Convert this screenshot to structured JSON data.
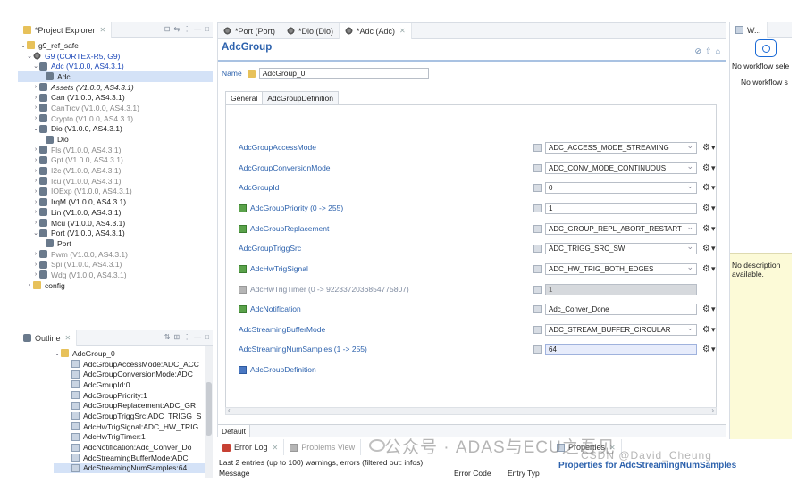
{
  "project_explorer": {
    "tab_label": "*Project Explorer",
    "tree": [
      {
        "label": "g9_ref_safe",
        "indent": 0,
        "twisty": "⌄",
        "icon": "folder",
        "style": ""
      },
      {
        "label": "G9 (CORTEX-R5, G9)",
        "indent": 1,
        "twisty": "⌄",
        "icon": "gear",
        "style": "blue"
      },
      {
        "label": "Adc (V1.0.0, AS4.3.1)",
        "indent": 2,
        "twisty": "⌄",
        "icon": "mod",
        "style": "blue"
      },
      {
        "label": "Adc",
        "indent": 3,
        "twisty": "",
        "icon": "mod",
        "style": "sel"
      },
      {
        "label": "Assets (V1.0.0, AS4.3.1)",
        "indent": 2,
        "twisty": "›",
        "icon": "mod",
        "style": "italic"
      },
      {
        "label": "Can (V1.0.0, AS4.3.1)",
        "indent": 2,
        "twisty": "›",
        "icon": "mod",
        "style": ""
      },
      {
        "label": "CanTrcv (V1.0.0, AS4.3.1)",
        "indent": 2,
        "twisty": "›",
        "icon": "mod",
        "style": "grey"
      },
      {
        "label": "Crypto (V1.0.0, AS4.3.1)",
        "indent": 2,
        "twisty": "›",
        "icon": "mod",
        "style": "grey"
      },
      {
        "label": "Dio (V1.0.0, AS4.3.1)",
        "indent": 2,
        "twisty": "⌄",
        "icon": "mod",
        "style": ""
      },
      {
        "label": "Dio",
        "indent": 3,
        "twisty": "",
        "icon": "mod",
        "style": ""
      },
      {
        "label": "Fls (V1.0.0, AS4.3.1)",
        "indent": 2,
        "twisty": "›",
        "icon": "mod",
        "style": "grey"
      },
      {
        "label": "Gpt (V1.0.0, AS4.3.1)",
        "indent": 2,
        "twisty": "›",
        "icon": "mod",
        "style": "grey"
      },
      {
        "label": "I2c (V1.0.0, AS4.3.1)",
        "indent": 2,
        "twisty": "›",
        "icon": "mod",
        "style": "grey"
      },
      {
        "label": "Icu (V1.0.0, AS4.3.1)",
        "indent": 2,
        "twisty": "›",
        "icon": "mod",
        "style": "grey"
      },
      {
        "label": "IOExp (V1.0.0, AS4.3.1)",
        "indent": 2,
        "twisty": "›",
        "icon": "mod",
        "style": "grey"
      },
      {
        "label": "IrqM (V1.0.0, AS4.3.1)",
        "indent": 2,
        "twisty": "›",
        "icon": "mod",
        "style": ""
      },
      {
        "label": "Lin (V1.0.0, AS4.3.1)",
        "indent": 2,
        "twisty": "›",
        "icon": "mod",
        "style": ""
      },
      {
        "label": "Mcu (V1.0.0, AS4.3.1)",
        "indent": 2,
        "twisty": "›",
        "icon": "mod",
        "style": ""
      },
      {
        "label": "Port (V1.0.0, AS4.3.1)",
        "indent": 2,
        "twisty": "⌄",
        "icon": "mod",
        "style": ""
      },
      {
        "label": "Port",
        "indent": 3,
        "twisty": "",
        "icon": "mod",
        "style": ""
      },
      {
        "label": "Pwm (V1.0.0, AS4.3.1)",
        "indent": 2,
        "twisty": "›",
        "icon": "mod",
        "style": "grey"
      },
      {
        "label": "Spi (V1.0.0, AS4.3.1)",
        "indent": 2,
        "twisty": "›",
        "icon": "mod",
        "style": "grey"
      },
      {
        "label": "Wdg (V1.0.0, AS4.3.1)",
        "indent": 2,
        "twisty": "›",
        "icon": "mod",
        "style": "grey"
      },
      {
        "label": "config",
        "indent": 1,
        "twisty": "›",
        "icon": "folder",
        "style": ""
      }
    ]
  },
  "outline": {
    "tab_label": "Outline",
    "items": [
      {
        "label": "AdcGroup_0",
        "indent": 0,
        "twisty": "⌄",
        "icon": "folder"
      },
      {
        "label": "AdcGroupAccessMode:ADC_ACC",
        "indent": 1,
        "twisty": "",
        "icon": "doc"
      },
      {
        "label": "AdcGroupConversionMode:ADC",
        "indent": 1,
        "twisty": "",
        "icon": "doc"
      },
      {
        "label": "AdcGroupId:0",
        "indent": 1,
        "twisty": "",
        "icon": "doc"
      },
      {
        "label": "AdcGroupPriority:1",
        "indent": 1,
        "twisty": "",
        "icon": "doc"
      },
      {
        "label": "AdcGroupReplacement:ADC_GR",
        "indent": 1,
        "twisty": "",
        "icon": "doc"
      },
      {
        "label": "AdcGroupTriggSrc:ADC_TRIGG_S",
        "indent": 1,
        "twisty": "",
        "icon": "doc"
      },
      {
        "label": "AdcHwTrigSignal:ADC_HW_TRIG",
        "indent": 1,
        "twisty": "",
        "icon": "doc"
      },
      {
        "label": "AdcHwTrigTimer:1",
        "indent": 1,
        "twisty": "",
        "icon": "doc"
      },
      {
        "label": "AdcNotification:Adc_Conver_Do",
        "indent": 1,
        "twisty": "",
        "icon": "doc"
      },
      {
        "label": "AdcStreamingBufferMode:ADC_",
        "indent": 1,
        "twisty": "",
        "icon": "doc"
      },
      {
        "label": "AdcStreamingNumSamples:64",
        "indent": 1,
        "twisty": "",
        "icon": "doc"
      }
    ]
  },
  "editor": {
    "tabs": [
      {
        "label": "*Port (Port)",
        "active": false
      },
      {
        "label": "*Dio (Dio)",
        "active": false
      },
      {
        "label": "*Adc (Adc)",
        "active": true
      }
    ],
    "title": "AdcGroup",
    "name_label": "Name",
    "name_value": "AdcGroup_0",
    "form_tabs": [
      "General",
      "AdcGroupDefinition"
    ],
    "params": [
      {
        "label": "AdcGroupAccessMode",
        "value": "ADC_ACCESS_MODE_STREAMING",
        "kind": "combo",
        "lead": "",
        "greyed": false
      },
      {
        "label": "AdcGroupConversionMode",
        "value": "ADC_CONV_MODE_CONTINUOUS",
        "kind": "combo",
        "lead": "",
        "greyed": false
      },
      {
        "label": "AdcGroupId",
        "value": "0",
        "kind": "combo",
        "lead": "",
        "greyed": false
      },
      {
        "label": "AdcGroupPriority (0 -> 255)",
        "value": "1",
        "kind": "text",
        "lead": "green",
        "greyed": false
      },
      {
        "label": "AdcGroupReplacement",
        "value": "ADC_GROUP_REPL_ABORT_RESTART",
        "kind": "combo",
        "lead": "green",
        "greyed": false
      },
      {
        "label": "AdcGroupTriggSrc",
        "value": "ADC_TRIGG_SRC_SW",
        "kind": "combo",
        "lead": "",
        "greyed": false
      },
      {
        "label": "AdcHwTrigSignal",
        "value": "ADC_HW_TRIG_BOTH_EDGES",
        "kind": "combo",
        "lead": "green",
        "greyed": false
      },
      {
        "label": "AdcHwTrigTimer (0 -> 9223372036854775807)",
        "value": "1",
        "kind": "disabled",
        "lead": "grey",
        "greyed": true
      },
      {
        "label": "AdcNotification",
        "value": "Adc_Conver_Done",
        "kind": "text",
        "lead": "green",
        "greyed": false
      },
      {
        "label": "AdcStreamingBufferMode",
        "value": "ADC_STREAM_BUFFER_CIRCULAR",
        "kind": "combo",
        "lead": "",
        "greyed": false
      },
      {
        "label": "AdcStreamingNumSamples (1 -> 255)",
        "value": "64",
        "kind": "hl",
        "lead": "",
        "greyed": false
      },
      {
        "label": "AdcGroupDefinition",
        "value": "",
        "kind": "link",
        "lead": "blue",
        "greyed": false
      }
    ],
    "bottom_tab": "Default"
  },
  "workflow": {
    "tab_label": "W...",
    "line1": "No workflow sele",
    "line2": "No workflow s",
    "description": "No description available."
  },
  "error_log": {
    "tabs": [
      "Error Log",
      "Problems View"
    ],
    "summary": "Last 2 entries (up to 100) warnings, errors (filtered out: infos)",
    "col_message": "Message",
    "col_error_code": "Error Code",
    "col_entry_type": "Entry Typ"
  },
  "properties": {
    "tab_label": "Properties",
    "title": "Properties for AdcStreamingNumSamples"
  },
  "watermark": "公众号 · ADAS与ECU之吾见",
  "watermark_sub": "CSDN @David_Cheung"
}
